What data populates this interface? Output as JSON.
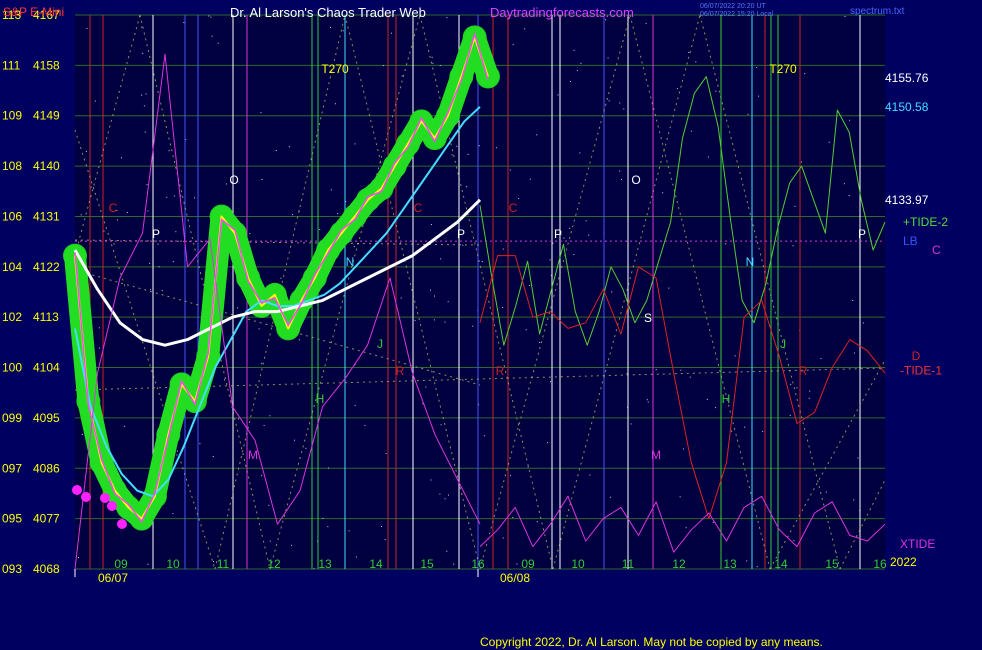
{
  "header": {
    "symbol": "S&P E-Mini",
    "title": "Dr. Al Larson's Chaos Trader Web",
    "site": "Daytradingforecasts.com",
    "timestamp_1": "06/07/2022 20:20 UT",
    "timestamp_2": "06/07/2022 15:20 Local",
    "file": "spectrum.txt"
  },
  "footer": {
    "copyright": "Copyright 2022, Dr. Al Larson. May not be copied by any means."
  },
  "colors": {
    "background": "#000060",
    "plot_bg": "#000040",
    "price": "#ffff00",
    "price_glow": "#22dd22",
    "fast_avg": "#ff44ff",
    "cyan_avg": "#44ddff",
    "white_avg": "#ffffff",
    "tide2": "#55cc33",
    "tide1": "#dd2222",
    "xtide": "#dd33dd",
    "channel": "#2233ff"
  },
  "chart_data": {
    "type": "line",
    "title": "S&P E-Mini",
    "y_left_outer": [
      "113",
      "111",
      "109",
      "108",
      "106",
      "104",
      "102",
      "100",
      "099",
      "097",
      "095",
      "093"
    ],
    "y_left_inner": [
      "4167",
      "4158",
      "4149",
      "4140",
      "4131",
      "4122",
      "4113",
      "4104",
      "4095",
      "4086",
      "4077",
      "4068"
    ],
    "ylim": [
      4068,
      4167
    ],
    "x_hour_labels": [
      "09",
      "10",
      "11",
      "12",
      "13",
      "14",
      "15",
      "16",
      "09",
      "10",
      "11",
      "12",
      "13",
      "14",
      "15",
      "16"
    ],
    "x_date_labels": [
      "06/07",
      "06/08"
    ],
    "year_label": "2022",
    "right_labels": [
      {
        "text": "4155.76",
        "value": 4155.76
      },
      {
        "text": "4150.58",
        "value": 4150.58
      },
      {
        "text": "4133.97",
        "value": 4133.97
      },
      {
        "text": "+TIDE-2",
        "value": 4130
      },
      {
        "text": "LB",
        "value": 4126.6
      },
      {
        "text": "C",
        "value": 4125
      },
      {
        "text": "-TIDE-1",
        "value": 4103.5
      },
      {
        "text": "XTIDE",
        "value": 4072.5
      }
    ],
    "series": [
      {
        "values": [
          4124,
          4098,
          4087,
          4082,
          4079,
          4077,
          4081,
          4092,
          4101,
          4098,
          4106,
          4131,
          4128,
          4120,
          4115,
          4117,
          4111,
          4116,
          4120,
          4125,
          4128,
          4131,
          4134,
          4136,
          4140,
          4144,
          4148,
          4145,
          4149,
          4156,
          4163,
          4156
        ]
      },
      {
        "values": [
          4111,
          4097,
          4090,
          4085,
          4082,
          4081,
          4084,
          4090,
          4097,
          4104,
          4109,
          4114,
          4116,
          4115,
          4115,
          4116,
          4117,
          4119,
          4122,
          4125,
          4128,
          4132,
          4136,
          4140,
          4144,
          4148,
          4150.58
        ]
      },
      {
        "values": [
          4125,
          4118,
          4112,
          4109,
          4108,
          4109,
          4111,
          4113,
          4114,
          4114,
          4115,
          4116,
          4118,
          4120,
          4122,
          4124,
          4127,
          4130,
          4133.97
        ]
      },
      {
        "values": [
          4133,
          4120,
          4108,
          4115,
          4123,
          4110,
          4118,
          4126,
          4114,
          4108,
          4114,
          4122,
          4118,
          4112,
          4116,
          4123,
          4130,
          4145,
          4153,
          4156,
          4147,
          4131,
          4116,
          4112,
          4119,
          4129,
          4137,
          4140,
          4134,
          4128,
          4150,
          4146,
          4134,
          4125,
          4130
        ]
      },
      {
        "values": [
          4112,
          4124,
          4124,
          4113,
          4114,
          4111,
          4112,
          4118,
          4110,
          4122,
          4120,
          4103,
          4087,
          4077,
          4087,
          4113,
          4116,
          4106,
          4094,
          4096,
          4104,
          4109,
          4107,
          4103
        ]
      },
      {
        "values": [
          4068,
          4103,
          4120,
          4128,
          4160,
          4122,
          4127,
          4097,
          4091,
          4076,
          4082,
          4097,
          4102,
          4108,
          4120,
          4103,
          4092,
          4084,
          4076
        ]
      },
      {
        "values": [
          4072,
          4075,
          4079,
          4072,
          4076,
          4081,
          4073,
          4077,
          4079,
          4074,
          4080,
          4071,
          4075,
          4078,
          4073,
          4079,
          4081,
          4075,
          4072,
          4078,
          4080,
          4074,
          4073,
          4076
        ]
      }
    ]
  },
  "chart_labels": {
    "planets": [
      "C",
      "O",
      "P",
      "N",
      "R",
      "J",
      "H",
      "M",
      "T270",
      "S",
      "C",
      "O",
      "P",
      "N",
      "R",
      "J",
      "H",
      "M",
      "T270",
      "P",
      "C",
      "P",
      "R",
      "S",
      "D"
    ]
  }
}
